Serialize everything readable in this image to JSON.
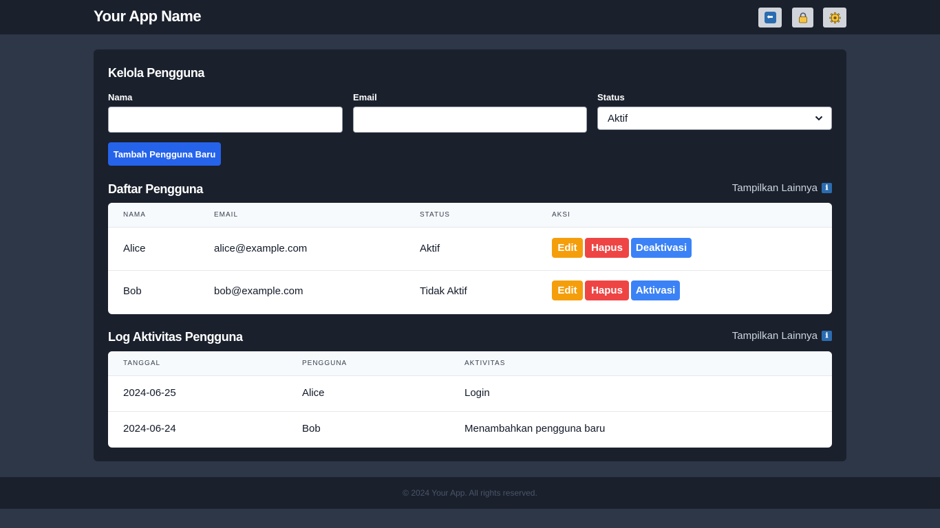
{
  "header": {
    "brand": "Your App Name",
    "buttons": [
      {
        "icon": "back-arrow-icon",
        "glyph": "⬅"
      },
      {
        "icon": "lock-icon",
        "glyph": "🔒"
      },
      {
        "icon": "gear-icon",
        "glyph": "⚙"
      }
    ]
  },
  "form": {
    "title": "Kelola Pengguna",
    "name_label": "Nama",
    "name_value": "",
    "email_label": "Email",
    "email_value": "",
    "status_label": "Status",
    "status_selected": "Aktif",
    "submit_label": "Tambah Pengguna Baru"
  },
  "users": {
    "title": "Daftar Pengguna",
    "more_label": "Tampilkan Lainnya",
    "more_icon": "ℹ",
    "columns": [
      "NAMA",
      "EMAIL",
      "STATUS",
      "AKSI"
    ],
    "rows": [
      {
        "name": "Alice",
        "email": "alice@example.com",
        "status": "Aktif",
        "edit": "Edit",
        "delete": "Hapus",
        "toggle": "Deaktivasi"
      },
      {
        "name": "Bob",
        "email": "bob@example.com",
        "status": "Tidak Aktif",
        "edit": "Edit",
        "delete": "Hapus",
        "toggle": "Aktivasi"
      }
    ]
  },
  "log": {
    "title": "Log Aktivitas Pengguna",
    "more_label": "Tampilkan Lainnya",
    "more_icon": "ℹ",
    "columns": [
      "TANGGAL",
      "PENGGUNA",
      "AKTIVITAS"
    ],
    "rows": [
      {
        "date": "2024-06-25",
        "user": "Alice",
        "activity": "Login"
      },
      {
        "date": "2024-06-24",
        "user": "Bob",
        "activity": "Menambahkan pengguna baru"
      }
    ]
  },
  "footer": {
    "text": "© 2024 Your App. All rights reserved."
  },
  "colors": {
    "page_bg": "#2d3748",
    "bar_bg": "#1a202c",
    "primary": "#2563eb",
    "edit": "#f59e0b",
    "delete": "#ef4444",
    "toggle": "#3b82f6"
  }
}
